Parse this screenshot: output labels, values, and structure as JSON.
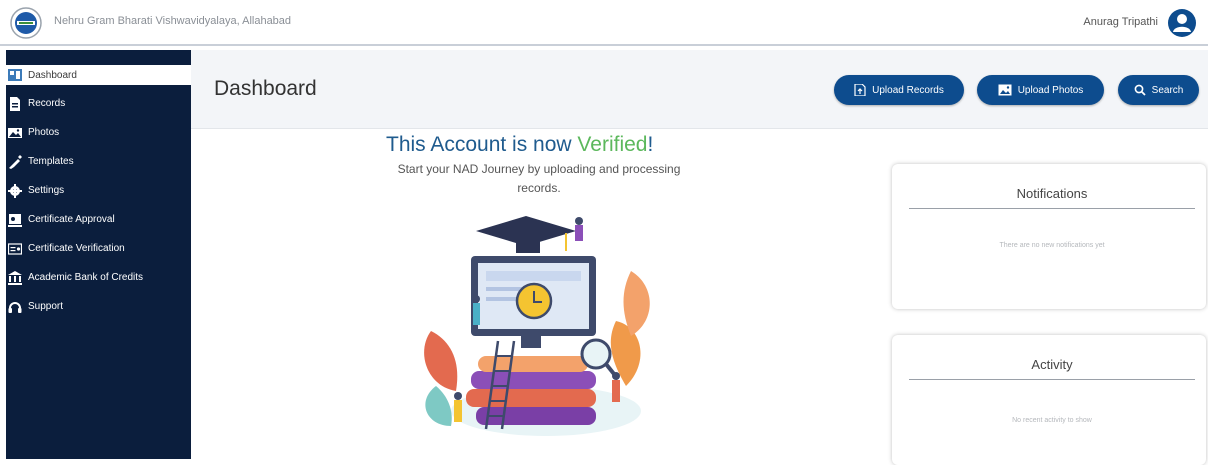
{
  "header": {
    "org_name": "Nehru Gram Bharati Vishwavidyalaya, Allahabad",
    "user_name": "Anurag Tripathi"
  },
  "sidebar": {
    "items": [
      {
        "label": "Dashboard",
        "icon": "dashboard-icon",
        "active": true
      },
      {
        "label": "Records",
        "icon": "records-icon"
      },
      {
        "label": "Photos",
        "icon": "photos-icon"
      },
      {
        "label": "Templates",
        "icon": "templates-icon"
      },
      {
        "label": "Settings",
        "icon": "settings-icon"
      },
      {
        "label": "Certificate Approval",
        "icon": "certificate-approval-icon"
      },
      {
        "label": "Certificate Verification",
        "icon": "certificate-verification-icon"
      },
      {
        "label": "Academic Bank of Credits",
        "icon": "bank-icon"
      },
      {
        "label": "Support",
        "icon": "headset-icon"
      }
    ]
  },
  "main": {
    "title": "Dashboard",
    "buttons": {
      "upload_records": "Upload Records",
      "upload_photos": "Upload Photos",
      "search": "Search"
    }
  },
  "welcome": {
    "title_prefix": "This Account is now ",
    "title_highlight": "Verified",
    "title_suffix": "!",
    "subtitle": "Start your NAD Journey by uploading and processing records."
  },
  "notifications": {
    "title": "Notifications",
    "empty_text": "There are no new notifications yet"
  },
  "activity": {
    "title": "Activity",
    "empty_text": "No recent activity to show"
  },
  "colors": {
    "primary": "#0d4c8e",
    "sidebar_bg": "#0b1e3d",
    "verified_green": "#5cb85c"
  }
}
